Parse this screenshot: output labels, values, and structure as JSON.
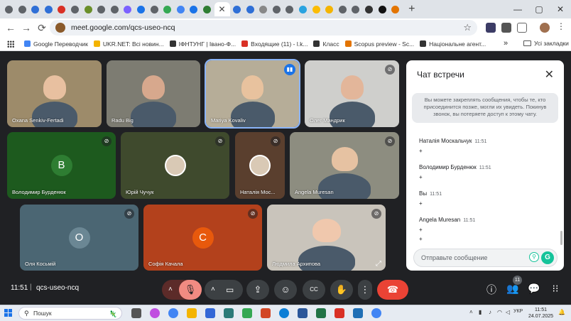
{
  "browser": {
    "tabs": [
      {
        "icon": "chrome-icon",
        "color": "#5f6368"
      },
      {
        "icon": "chrome-icon",
        "color": "#5f6368"
      },
      {
        "icon": "doc-icon",
        "color": "#2f6fd6"
      },
      {
        "icon": "doc-icon",
        "color": "#2f6fd6"
      },
      {
        "icon": "gmail-icon",
        "color": "#d93025"
      },
      {
        "icon": "chrome-icon",
        "color": "#5f6368"
      },
      {
        "icon": "bookmark-icon",
        "color": "#6a8f2a"
      },
      {
        "icon": "chrome-icon",
        "color": "#5f6368"
      },
      {
        "icon": "chrome-icon",
        "color": "#5f6368"
      },
      {
        "icon": "gemini-icon",
        "color": "#7b61ff"
      },
      {
        "icon": "web-icon",
        "color": "#1a73e8"
      },
      {
        "icon": "chrome-icon",
        "color": "#5f6368"
      },
      {
        "icon": "maps-icon",
        "color": "#34a853"
      },
      {
        "icon": "google-icon",
        "color": "#4285f4"
      },
      {
        "icon": "web-icon",
        "color": "#1a73e8"
      },
      {
        "icon": "classroom-icon",
        "color": "#2e7d32"
      }
    ],
    "tabs_after": [
      {
        "icon": "doc-icon",
        "color": "#2f6fd6"
      },
      {
        "icon": "doc-icon",
        "color": "#2f6fd6"
      },
      {
        "icon": "web-icon",
        "color": "#888888"
      },
      {
        "icon": "chrome-icon",
        "color": "#5f6368"
      },
      {
        "icon": "chrome-icon",
        "color": "#5f6368"
      },
      {
        "icon": "telegram-icon",
        "color": "#2aa3e0"
      },
      {
        "icon": "drive-icon",
        "color": "#fbbc04"
      },
      {
        "icon": "slides-icon",
        "color": "#f4b400"
      },
      {
        "icon": "chrome-icon",
        "color": "#5f6368"
      },
      {
        "icon": "chrome-icon",
        "color": "#5f6368"
      },
      {
        "icon": "chatgpt-icon",
        "color": "#333333"
      },
      {
        "icon": "tiktok-icon",
        "color": "#111111"
      },
      {
        "icon": "web-icon",
        "color": "#e37400"
      }
    ],
    "url": "meet.google.com/qcs-useo-ncq",
    "bookmarks": [
      {
        "label": "Google Переводчик",
        "color": "#4285f4"
      },
      {
        "label": "UKR.NET: Всі новин...",
        "color": "#f4b400"
      },
      {
        "label": "ІФНТУНГ | Івано-Ф...",
        "color": "#333333"
      },
      {
        "label": "Входящие (11) - l.k...",
        "color": "#d93025"
      },
      {
        "label": "Класс",
        "color": "#333333"
      },
      {
        "label": "Scopus preview - Sc...",
        "color": "#e37400"
      },
      {
        "label": "Національне агент...",
        "color": "#333333"
      }
    ],
    "bookmarks_more": "»",
    "bookmarks_folder": "Усі закладки"
  },
  "participants": [
    {
      "name": "Oxana Senkiv-Fertadi",
      "kind": "video",
      "bg": "#9d8b6a",
      "skin": "#e8c0a0",
      "muted": false
    },
    {
      "name": "Radu Big",
      "kind": "video",
      "bg": "#7d7c72",
      "skin": "#d7a88d",
      "muted": false
    },
    {
      "name": "Mariya Kovaliv",
      "kind": "video",
      "bg": "#b6ad98",
      "skin": "#e8c29e",
      "muted": false,
      "speaking": true
    },
    {
      "name": "Олег Мандрик",
      "kind": "video",
      "bg": "#cfcfcc",
      "skin": "#e3b69a",
      "muted": true
    },
    {
      "name": "Володимир Бурденюк",
      "kind": "avatar",
      "bg": "#1d5a1e",
      "letter": "B",
      "avatar_color": "#2e7d32",
      "muted": true
    },
    {
      "name": "Юрій Чучук",
      "kind": "video-small",
      "bg": "#3f4a2d",
      "muted": true
    },
    {
      "name": "Наталія Мос...",
      "kind": "video-small",
      "bg": "#5a3f2e",
      "muted": true
    },
    {
      "name": "Angela Muresan",
      "kind": "video",
      "bg": "#8d8d80",
      "skin": "#e6c2a2",
      "muted": true
    },
    {
      "name": "Оля Косьмій",
      "kind": "avatar",
      "bg": "#4b6673",
      "letter": "O",
      "avatar_color": "#6b8794",
      "muted": true
    },
    {
      "name": "Софія Качала",
      "kind": "avatar",
      "bg": "#b3411c",
      "letter": "C",
      "avatar_color": "#e8590c",
      "muted": true
    },
    {
      "name": "Людмила Архипова",
      "kind": "video",
      "bg": "#c9c4bb",
      "skin": "#f0c8ad",
      "muted": true
    }
  ],
  "chat": {
    "title": "Чат встречи",
    "notice": "Вы можете закреплять сообщения, чтобы те, кто присоединится позже, могли их увидеть. Покинув звонок, вы потеряете доступ к этому чату.",
    "messages": [
      {
        "sender": "Наталія Москальчук",
        "time": "11:51",
        "lines": [
          "+"
        ]
      },
      {
        "sender": "Володимир Бурденюк",
        "time": "11:51",
        "lines": [
          "+"
        ]
      },
      {
        "sender": "Вы",
        "time": "11:51",
        "lines": [
          "+"
        ]
      },
      {
        "sender": "Angela Muresan",
        "time": "11:51",
        "lines": [
          "+",
          "+"
        ]
      }
    ],
    "placeholder": "Отправьте сообщение"
  },
  "meeting": {
    "clock": "11:51",
    "separator": "|",
    "code": "qcs-useo-ncq",
    "participant_count": "11"
  },
  "taskbar": {
    "search_label": "Пошук",
    "apps": [
      {
        "icon": "task-view-icon",
        "color": "#555555"
      },
      {
        "icon": "copilot-icon",
        "color": "#c04ee0"
      },
      {
        "icon": "chrome-icon",
        "color": "#4285f4"
      },
      {
        "icon": "folder-icon",
        "color": "#f4b400"
      },
      {
        "icon": "save-icon",
        "color": "#3367d6"
      },
      {
        "icon": "calculator-icon",
        "color": "#2b7a78"
      },
      {
        "icon": "photos-icon",
        "color": "#34a853"
      },
      {
        "icon": "powerpoint-icon",
        "color": "#d24726"
      },
      {
        "icon": "edge-icon",
        "color": "#0c7fd6"
      },
      {
        "icon": "word-icon",
        "color": "#2b579a"
      },
      {
        "icon": "excel-icon",
        "color": "#217346"
      },
      {
        "icon": "pdf-icon",
        "color": "#d93025"
      },
      {
        "icon": "vscode-icon",
        "color": "#1f6fb5"
      },
      {
        "icon": "chrome-icon",
        "color": "#4285f4"
      }
    ],
    "lang": "УКР",
    "time": "11:51",
    "date": "24.07.2025"
  }
}
